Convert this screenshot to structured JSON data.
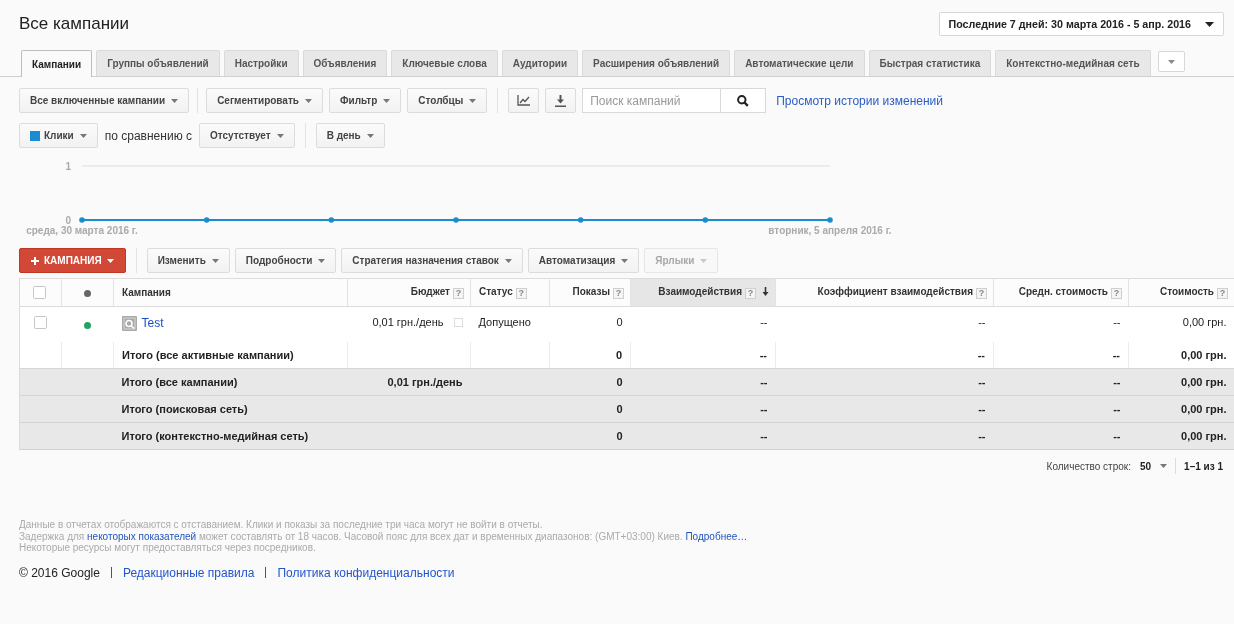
{
  "header": {
    "title": "Все кампании",
    "date_range": "Последние 7 дней: 30 марта 2016 - 5 апр. 2016"
  },
  "tabs": [
    {
      "label": "Кампании",
      "selected": true
    },
    {
      "label": "Группы объявлений",
      "selected": false
    },
    {
      "label": "Настройки",
      "selected": false
    },
    {
      "label": "Объявления",
      "selected": false
    },
    {
      "label": "Ключевые слова",
      "selected": false
    },
    {
      "label": "Аудитории",
      "selected": false
    },
    {
      "label": "Расширения объявлений",
      "selected": false
    },
    {
      "label": "Автоматические цели",
      "selected": false
    },
    {
      "label": "Быстрая статистика",
      "selected": false
    },
    {
      "label": "Контекстно-медийная сеть",
      "selected": false
    }
  ],
  "toolbar": {
    "scope": "Все включенные кампании",
    "menus": [
      "Сегментировать",
      "Фильтр",
      "Столбцы"
    ],
    "search": {
      "placeholder": "Поиск кампаний"
    },
    "history_link": "Просмотр истории изменений"
  },
  "chart_controls": {
    "metric": "Клики",
    "compare_label": "по сравнению с",
    "compare": "Отсутствует",
    "interval": "В день"
  },
  "chart": {
    "chart_data": {
      "type": "line",
      "categories": [
        "среда, 30 марта 2016 г.",
        null,
        null,
        null,
        null,
        null,
        "вторник, 5 апреля 2016 г."
      ],
      "ylim": [
        0,
        1
      ],
      "yticks": [
        0,
        1
      ],
      "series": [
        {
          "color": "#1a8ccf",
          "values": [
            0,
            0,
            0,
            0,
            0,
            0,
            0
          ]
        }
      ]
    }
  },
  "actions": [
    {
      "kind": "primary",
      "label": "КАМПАНИЯ",
      "disabled": false
    },
    {
      "kind": "menu",
      "label": "Изменить",
      "disabled": false
    },
    {
      "kind": "menu",
      "label": "Подробности",
      "disabled": false
    },
    {
      "kind": "menu",
      "label": "Стратегия назначения ставок",
      "disabled": false
    },
    {
      "kind": "menu",
      "label": "Автоматизация",
      "disabled": false
    },
    {
      "kind": "menu",
      "label": "Ярлыки",
      "disabled": true
    }
  ],
  "table": {
    "select_all": {
      "checked": false
    },
    "columns": [
      {
        "label": "Кампания",
        "sorted": false
      },
      {
        "label": "Бюджет",
        "help": "?",
        "sorted": false
      },
      {
        "label": "Статус",
        "help": "?",
        "sorted": false
      },
      {
        "label": "Показы",
        "help": "?",
        "sorted": false
      },
      {
        "label": "Взаимодействия",
        "help": "?",
        "sorted": true
      },
      {
        "label": "Коэффициент взаимодействия",
        "help": "?",
        "sorted": false
      },
      {
        "label": "Средн. стоимость",
        "help": "?",
        "sorted": false
      },
      {
        "label": "Стоимость",
        "help": "?",
        "sorted": false
      }
    ],
    "rows": [
      {
        "kind": "campaign",
        "checked": false,
        "color": "#1fa463",
        "cells": [
          "Test",
          "0,01 грн./день",
          "Допущено",
          "0",
          "--",
          "--",
          "--",
          "0,00 грн."
        ]
      },
      {
        "kind": "active_total",
        "cells": [
          "Итого (все активные кампании)",
          null,
          null,
          "0",
          "--",
          "--",
          "--",
          "0,00 грн."
        ]
      },
      {
        "kind": "total",
        "cells": [
          "Итого (все кампании)",
          "0,01 грн./день",
          null,
          "0",
          "--",
          "--",
          "--",
          "0,00 грн."
        ]
      },
      {
        "kind": "total",
        "cells": [
          "Итого (поисковая сеть)",
          null,
          null,
          "0",
          "--",
          "--",
          "--",
          "0,00 грн."
        ]
      },
      {
        "kind": "total",
        "cells": [
          "Итого (контекстно-медийная сеть)",
          null,
          null,
          "0",
          "--",
          "--",
          "--",
          "0,00 грн."
        ]
      }
    ]
  },
  "pager": {
    "label": "Количество строк:",
    "page_size": "50",
    "range": "1–1 из 1"
  },
  "footer": {
    "notes": [
      {
        "parts": [
          {
            "kind": "text",
            "text": "Данные в отчетах отображаются с отставанием. Клики и показы за последние три часа могут не войти в отчеты."
          }
        ]
      },
      {
        "parts": [
          {
            "kind": "text",
            "text": "Задержка для "
          },
          {
            "kind": "link",
            "text": "некоторых показателей"
          },
          {
            "kind": "text",
            "text": " может составлять от 18 часов. Часовой пояс для всех дат и временных диапазонов: (GMT+03:00) Киев. "
          },
          {
            "kind": "link",
            "text": "Подробнее…"
          }
        ]
      },
      {
        "parts": [
          {
            "kind": "text",
            "text": "Некоторые ресурсы могут предоставляться через посредников."
          }
        ]
      }
    ],
    "links": [
      {
        "kind": "text",
        "text": "© 2016 Google"
      },
      {
        "kind": "link",
        "text": "Редакционные правила"
      },
      {
        "kind": "link",
        "text": "Политика конфиденциальности"
      }
    ]
  }
}
